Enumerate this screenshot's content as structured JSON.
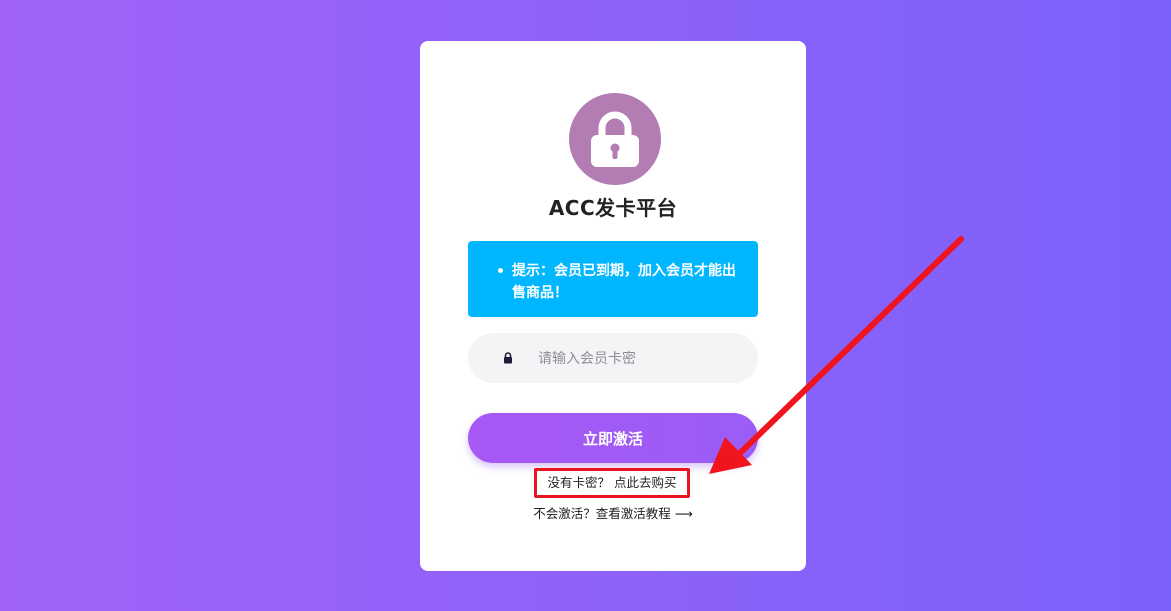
{
  "app": {
    "title": "ACC发卡平台",
    "logo_icon": "lock-icon"
  },
  "notice": {
    "text": "提示：会员已到期，加入会员才能出售商品！"
  },
  "card_input": {
    "value": "",
    "placeholder": "请输入会员卡密",
    "icon": "lock-icon"
  },
  "activate_button": {
    "label": "立即激活"
  },
  "links": {
    "buy": "没有卡密？ 点此去购买",
    "tutorial": "不会激活？查看激活教程 ⟶"
  },
  "annotation": {
    "highlight_color": "#e8141f",
    "arrow_color": "#f0141e"
  },
  "colors": {
    "background_start": "#a163f7",
    "background_end": "#7d61fb",
    "avatar": "#b37db3",
    "notice": "#00b7ff",
    "button": "#a758f5"
  }
}
